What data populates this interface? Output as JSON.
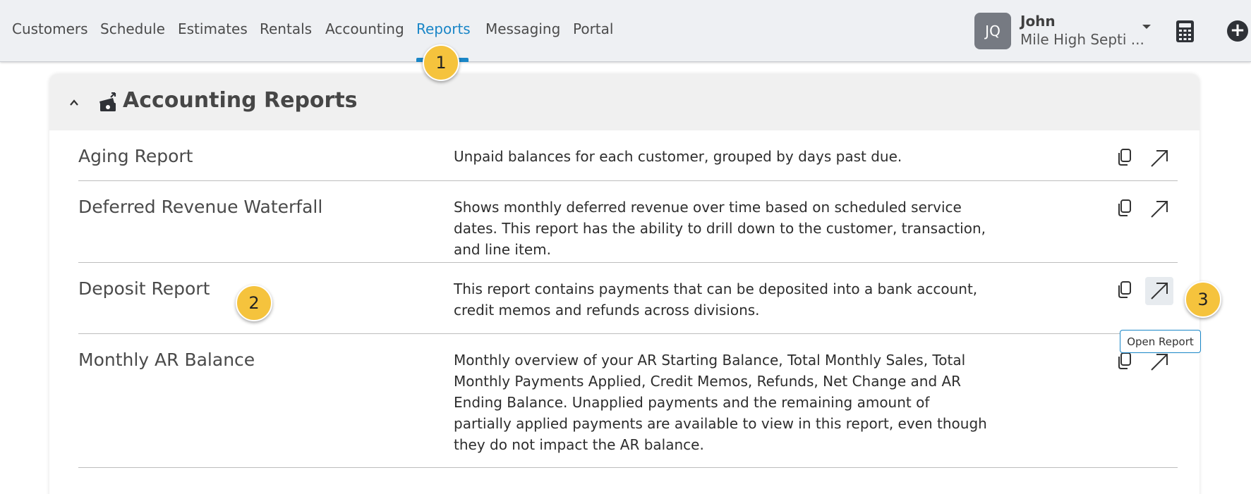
{
  "nav": {
    "items": [
      {
        "label": "Customers",
        "active": false
      },
      {
        "label": "Schedule",
        "active": false
      },
      {
        "label": "Estimates",
        "active": false
      },
      {
        "label": "Rentals",
        "active": false
      },
      {
        "label": "Accounting",
        "active": false
      },
      {
        "label": "Reports",
        "active": true
      },
      {
        "label": "Messaging",
        "active": false
      },
      {
        "label": "Portal",
        "active": false
      }
    ],
    "accent_color": "#1a86c7"
  },
  "user": {
    "initials": "JQ",
    "name": "John",
    "organization": "Mile High Septi ..."
  },
  "icons": {
    "calculator": "calculator-icon",
    "add": "plus-circle-icon",
    "collapse": "chevron-up-icon",
    "section": "money-icon",
    "copy": "copy-icon",
    "open": "arrow-up-right-icon"
  },
  "section": {
    "title": "Accounting Reports",
    "reports": [
      {
        "name": "Aging Report",
        "description": "Unpaid balances for each customer, grouped by days past due."
      },
      {
        "name": "Deferred Revenue Waterfall",
        "description": "Shows monthly deferred revenue over time based on scheduled service dates. This report has the ability to drill down to the customer, transaction, and line item."
      },
      {
        "name": "Deposit Report",
        "description": "This report contains payments that can be deposited into a bank account, credit memos and refunds across divisions."
      },
      {
        "name": "Monthly AR Balance",
        "description": "Monthly overview of your AR Starting Balance, Total Monthly Sales, Total Monthly Payments Applied, Credit Memos, Refunds, Net Change and AR Ending Balance. Unapplied payments and the remaining amount of partially applied payments are available to view in this report, even though they do not impact the AR balance."
      }
    ]
  },
  "tooltip": {
    "text": "Open Report"
  },
  "markers": [
    "1",
    "2",
    "3"
  ]
}
